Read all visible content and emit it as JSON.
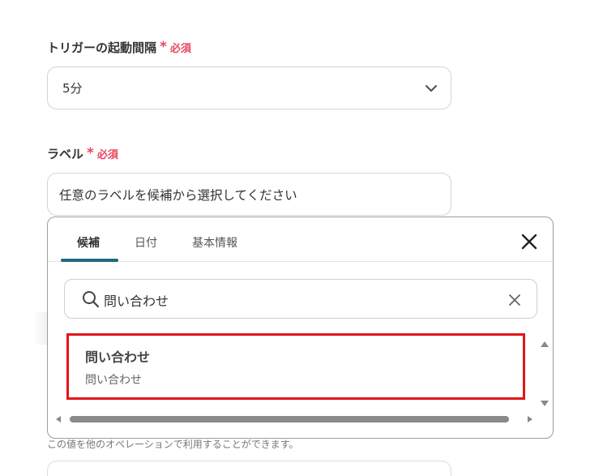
{
  "trigger_interval": {
    "label": "トリガーの起動間隔",
    "required_mark": "*",
    "required_text": "必須",
    "value": "5分",
    "icon": "chevron-down-icon"
  },
  "label_field": {
    "label": "ラベル",
    "required_mark": "*",
    "required_text": "必須",
    "placeholder": "任意のラベルを候補から選択してください"
  },
  "popover": {
    "tabs": [
      {
        "label": "候補",
        "active": true
      },
      {
        "label": "日付",
        "active": false
      },
      {
        "label": "基本情報",
        "active": false
      }
    ],
    "close_icon": "close-icon",
    "search": {
      "value": "問い合わせ",
      "icon": "search-icon",
      "clear_icon": "clear-icon"
    },
    "results": [
      {
        "title": "問い合わせ",
        "subtitle": "問い合わせ",
        "highlighted": true
      }
    ],
    "highlight_color": "#e0161b",
    "accent_color": "#1f6a7a"
  },
  "helper_text": "この値を他のオペレーションで利用することができます。",
  "colors": {
    "required": "#e8455f"
  }
}
